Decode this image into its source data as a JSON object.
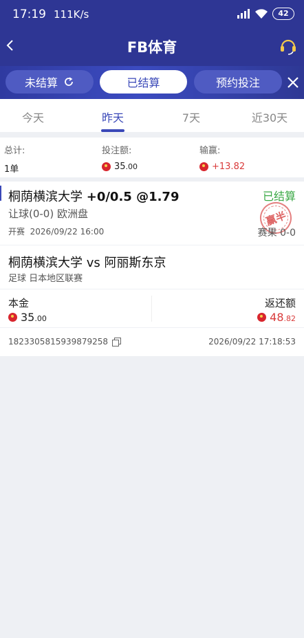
{
  "statusbar": {
    "time": "17:19",
    "speed": "111K/s",
    "battery": "42"
  },
  "header": {
    "title": "FB体育"
  },
  "filters": [
    {
      "label": "未结算"
    },
    {
      "label": "已结算"
    },
    {
      "label": "预约投注"
    }
  ],
  "tabs": [
    {
      "label": "今天"
    },
    {
      "label": "昨天"
    },
    {
      "label": "7天"
    },
    {
      "label": "近30天"
    }
  ],
  "summary": {
    "total_label": "总计:",
    "total_value": "1单",
    "stake_label": "投注额:",
    "stake_int": "35",
    "stake_dec": ".00",
    "win_label": "输赢:",
    "win_value": "+13.82"
  },
  "bet": {
    "team": "桐荫横滨大学",
    "odds_line": "+0/0.5 @1.79",
    "status": "已结算",
    "market": "让球(0-0) 欧洲盘",
    "start_label": "开赛",
    "start_time": "2026/09/22 16:00",
    "result_label": "赛果",
    "result_score": "0-0",
    "stamp": "赢半",
    "match": "桐荫横滨大学 vs 阿丽斯东京",
    "league": "足球  日本地区联赛",
    "stake_label": "本金",
    "stake_int": "35",
    "stake_dec": ".00",
    "return_label": "返还额",
    "return_int": "48",
    "return_dec": ".82",
    "order_id": "1823305815939879258",
    "settle_time": "2026/09/22 17:18:53"
  },
  "colors": {
    "brand": "#2e3694",
    "accent": "#3a48b8",
    "win": "#d93a3a",
    "settled": "#3aa845"
  }
}
